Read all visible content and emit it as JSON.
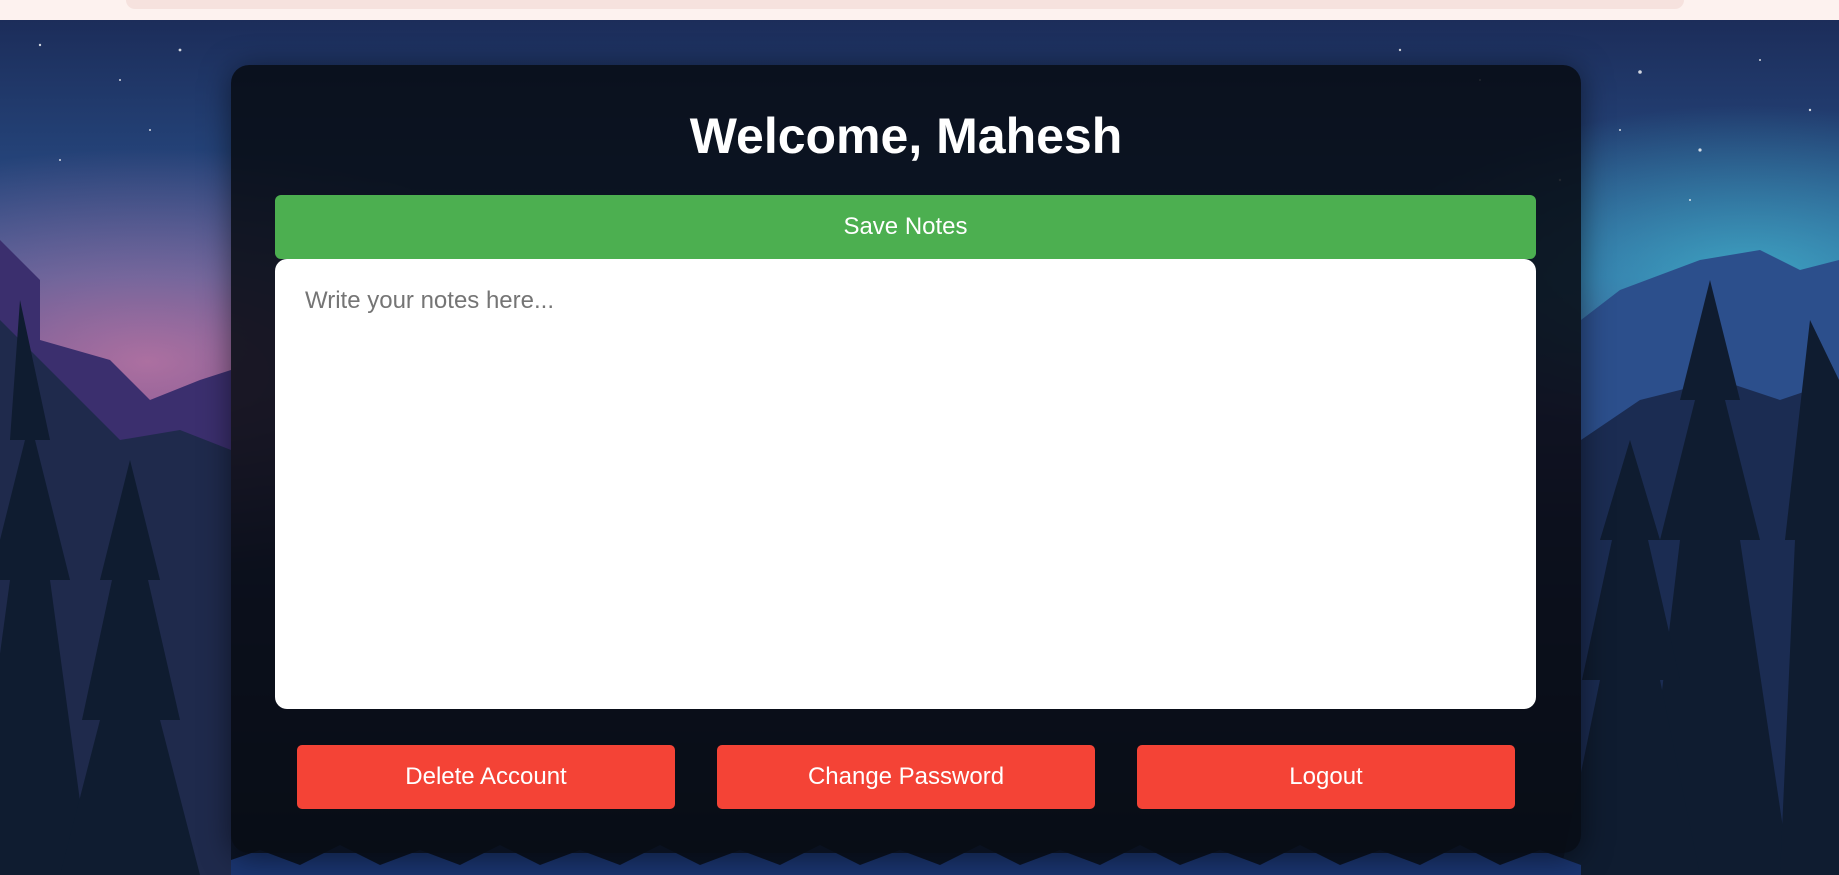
{
  "header": {
    "title": "Welcome, Mahesh"
  },
  "notes": {
    "save_label": "Save Notes",
    "placeholder": "Write your notes here...",
    "value": ""
  },
  "actions": {
    "delete_label": "Delete Account",
    "change_password_label": "Change Password",
    "logout_label": "Logout"
  },
  "colors": {
    "save_button": "#4caf50",
    "action_button": "#f44336",
    "card_background": "#080c14"
  }
}
